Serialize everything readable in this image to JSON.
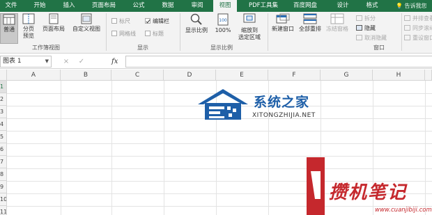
{
  "ribbon_tabs": [
    "文件",
    "开始",
    "插入",
    "页面布局",
    "公式",
    "数据",
    "审阅",
    "视图",
    "PDF工具集",
    "百度网盘",
    "设计",
    "格式"
  ],
  "active_tab": "视图",
  "tell_me": "告诉我您",
  "workbook_views": {
    "normal": "普通",
    "page_break": "分页\n预览",
    "page_layout": "页面布局",
    "custom_views": "自定义视图",
    "group_label": "工作簿视图"
  },
  "show": {
    "ruler": "标尺",
    "formula_bar": "编辑栏",
    "gridlines": "网格线",
    "headings": "标题",
    "group_label": "显示"
  },
  "zoom": {
    "zoom": "显示比例",
    "hundred": "100%",
    "zoom_to_selection": "缩放到\n选定区域",
    "group_label": "显示比例"
  },
  "window": {
    "new_window": "新建窗口",
    "arrange_all": "全部重排",
    "freeze_panes": "冻结窗格",
    "split": "拆分",
    "hide": "隐藏",
    "unhide": "取消隐藏",
    "side_by_side": "并排查看",
    "sync_scroll": "同步滚动",
    "reset_position": "重设窗口",
    "group_label": "窗口"
  },
  "formula_bar": {
    "name_box": "图表 1",
    "cancel": "×",
    "enter": "✓",
    "fx": "fx",
    "value": ""
  },
  "columns": [
    "A",
    "B",
    "C",
    "D",
    "E",
    "F",
    "G",
    "H"
  ],
  "rows": [
    "1",
    "2",
    "3",
    "4",
    "5",
    "6",
    "7",
    "8",
    "9",
    "10",
    "11"
  ],
  "watermark1": {
    "title": "系统之家",
    "url": "XITONGZHIJIA.NET"
  },
  "watermark2": {
    "title": "攒机笔记",
    "url": "www.cuanjibiji.com"
  },
  "colors": {
    "ribbon_green": "#217346",
    "ribbon_bg": "#f3f3f3",
    "watermark_blue": "#1e5fa8",
    "watermark_red": "#c5282d"
  }
}
